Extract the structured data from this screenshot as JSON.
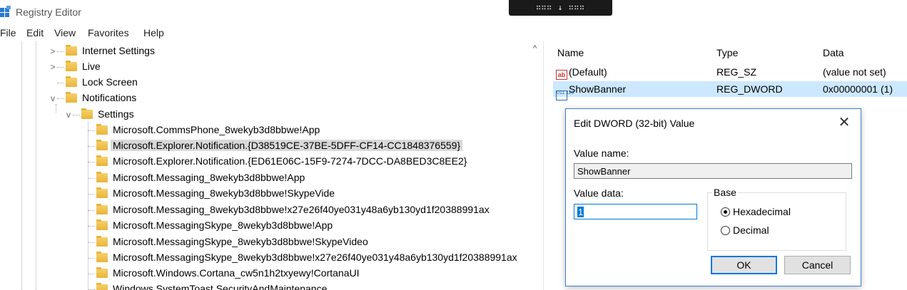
{
  "window": {
    "title": "Registry Editor"
  },
  "menu": [
    "File",
    "Edit",
    "View",
    "Favorites",
    "Help"
  ],
  "tree": [
    {
      "label": "Internet Settings",
      "chevron": ">",
      "indent": 1
    },
    {
      "label": "Live",
      "chevron": ">",
      "indent": 1
    },
    {
      "label": "Lock Screen",
      "chevron": "",
      "indent": 1
    },
    {
      "label": "Notifications",
      "chevron": "v",
      "indent": 1
    },
    {
      "label": "Settings",
      "chevron": "v",
      "indent": 2
    },
    {
      "label": "Microsoft.CommsPhone_8wekyb3d8bbwe!App",
      "chevron": "",
      "indent": 3
    },
    {
      "label": "Microsoft.Explorer.Notification.{D38519CE-37BE-5DFF-CF14-CC1848376559}",
      "chevron": "",
      "indent": 3,
      "selected": true
    },
    {
      "label": "Microsoft.Explorer.Notification.{ED61E06C-15F9-7274-7DCC-DA8BED3C8EE2}",
      "chevron": "",
      "indent": 3
    },
    {
      "label": "Microsoft.Messaging_8wekyb3d8bbwe!App",
      "chevron": "",
      "indent": 3
    },
    {
      "label": "Microsoft.Messaging_8wekyb3d8bbwe!SkypeVide",
      "chevron": "",
      "indent": 3
    },
    {
      "label": "Microsoft.Messaging_8wekyb3d8bbwe!x27e26f40ye031y48a6yb130yd1f20388991ax",
      "chevron": "",
      "indent": 3
    },
    {
      "label": "Microsoft.MessagingSkype_8wekyb3d8bbwe!App",
      "chevron": "",
      "indent": 3
    },
    {
      "label": "Microsoft.MessagingSkype_8wekyb3d8bbwe!SkypeVideo",
      "chevron": "",
      "indent": 3
    },
    {
      "label": "Microsoft.MessagingSkype_8wekyb3d8bbwe!x27e26f40ye031y48a6yb130yd1f20388991ax",
      "chevron": "",
      "indent": 3
    },
    {
      "label": "Microsoft.Windows.Cortana_cw5n1h2txyewy!CortanaUI",
      "chevron": "",
      "indent": 3
    },
    {
      "label": "Windows.SystemToast.SecurityAndMaintenance",
      "chevron": "",
      "indent": 3
    }
  ],
  "values_pane": {
    "headers": {
      "name": "Name",
      "type": "Type",
      "data": "Data"
    },
    "rows": [
      {
        "icon": "string-value-icon",
        "icon_text": "ab",
        "name": "(Default)",
        "type": "REG_SZ",
        "data": "(value not set)"
      },
      {
        "icon": "binary-value-icon",
        "icon_text": "011 110",
        "name": "ShowBanner",
        "type": "REG_DWORD",
        "data": "0x00000001 (1)",
        "selected": true
      }
    ]
  },
  "dialog": {
    "title": "Edit DWORD (32-bit) Value",
    "close_glyph": "✕",
    "value_name_label": "Value name:",
    "value_name": "ShowBanner",
    "value_data_label": "Value data:",
    "value_data": "1",
    "base_label": "Base",
    "radio_hex": "Hexadecimal",
    "radio_dec": "Decimal",
    "base_selected": "hexadecimal",
    "ok": "OK",
    "cancel": "Cancel"
  },
  "drag_pill": {
    "glyph": "∷∷∷ ↓ ∷∷∷"
  },
  "colors": {
    "selection": "#cce8ff",
    "accent": "#0078d7",
    "folder": "#f0c050"
  }
}
